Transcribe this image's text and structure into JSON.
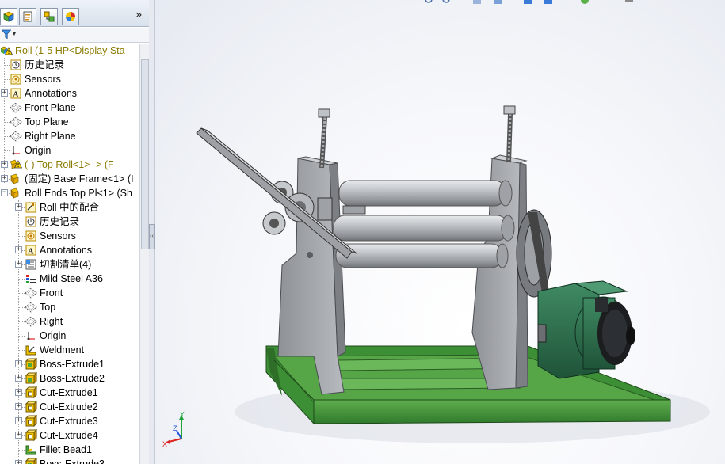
{
  "panel": {
    "tabs": [
      {
        "name": "feature-manager-tab-icon",
        "active": true
      },
      {
        "name": "property-manager-tab-icon",
        "active": false
      },
      {
        "name": "configuration-manager-tab-icon",
        "active": false
      },
      {
        "name": "display-manager-tab-icon",
        "active": false
      }
    ],
    "more_glyph": "»",
    "filter_icon": "funnel-icon"
  },
  "tree": {
    "items": [
      {
        "label": "Roll  (1-5 HP<Display Sta",
        "icon": "assembly-warning-icon",
        "expander": false,
        "level": 0,
        "highlight": true
      },
      {
        "label": "历史记录",
        "icon": "history-icon",
        "expander": false,
        "level": 1
      },
      {
        "label": "Sensors",
        "icon": "sensors-icon",
        "expander": false,
        "level": 1
      },
      {
        "label": "Annotations",
        "icon": "annotations-icon",
        "expander": true,
        "level": 1
      },
      {
        "label": "Front Plane",
        "icon": "plane-icon",
        "expander": false,
        "level": 1
      },
      {
        "label": "Top Plane",
        "icon": "plane-icon",
        "expander": false,
        "level": 1
      },
      {
        "label": "Right Plane",
        "icon": "plane-icon",
        "expander": false,
        "level": 1
      },
      {
        "label": "Origin",
        "icon": "origin-icon",
        "expander": false,
        "level": 1
      },
      {
        "label": "(-) Top Roll<1> -> (F",
        "icon": "part-warning-icon",
        "expander": true,
        "level": 1,
        "highlight": true
      },
      {
        "label": "(固定) Base Frame<1> (I",
        "icon": "part-icon",
        "expander": true,
        "level": 1
      },
      {
        "label": "Roll Ends Top Pl<1> (Sh",
        "icon": "part-icon",
        "expander": true,
        "level": 1,
        "expanded": true
      },
      {
        "label": "Roll 中的配合",
        "icon": "mates-icon",
        "expander": true,
        "level": 2
      },
      {
        "label": "历史记录",
        "icon": "history-icon",
        "expander": false,
        "level": 2
      },
      {
        "label": "Sensors",
        "icon": "sensors-icon",
        "expander": false,
        "level": 2
      },
      {
        "label": "Annotations",
        "icon": "annotations-icon",
        "expander": true,
        "level": 2
      },
      {
        "label": "切割清单(4)",
        "icon": "cut-list-icon",
        "expander": true,
        "level": 2
      },
      {
        "label": "Mild Steel A36",
        "icon": "material-icon",
        "expander": false,
        "level": 2
      },
      {
        "label": "Front",
        "icon": "plane-icon",
        "expander": false,
        "level": 2
      },
      {
        "label": "Top",
        "icon": "plane-icon",
        "expander": false,
        "level": 2
      },
      {
        "label": "Right",
        "icon": "plane-icon",
        "expander": false,
        "level": 2
      },
      {
        "label": "Origin",
        "icon": "origin-icon",
        "expander": false,
        "level": 2
      },
      {
        "label": "Weldment",
        "icon": "weldment-icon",
        "expander": false,
        "level": 2
      },
      {
        "label": "Boss-Extrude1",
        "icon": "boss-extrude-icon",
        "expander": true,
        "level": 2
      },
      {
        "label": "Boss-Extrude2",
        "icon": "boss-extrude-icon",
        "expander": true,
        "level": 2
      },
      {
        "label": "Cut-Extrude1",
        "icon": "cut-extrude-icon",
        "expander": true,
        "level": 2
      },
      {
        "label": "Cut-Extrude2",
        "icon": "cut-extrude-icon",
        "expander": true,
        "level": 2
      },
      {
        "label": "Cut-Extrude3",
        "icon": "cut-extrude-icon",
        "expander": true,
        "level": 2
      },
      {
        "label": "Cut-Extrude4",
        "icon": "cut-extrude-icon",
        "expander": true,
        "level": 2
      },
      {
        "label": "Fillet Bead1",
        "icon": "fillet-bead-icon",
        "expander": false,
        "level": 2
      },
      {
        "label": "Boss-Extrude3",
        "icon": "boss-extrude-icon",
        "expander": true,
        "level": 2
      }
    ]
  },
  "splitter": {
    "glyph": "‹‹"
  },
  "triad": {
    "x": "X",
    "y": "Y",
    "z": "Z"
  },
  "colors": {
    "frame_green": "#3f8f3a",
    "motor_green": "#2f6e4e",
    "roller_grey": "#b9bec4",
    "plate_grey": "#a7aaae",
    "highlight_text": "#8a7a00"
  }
}
